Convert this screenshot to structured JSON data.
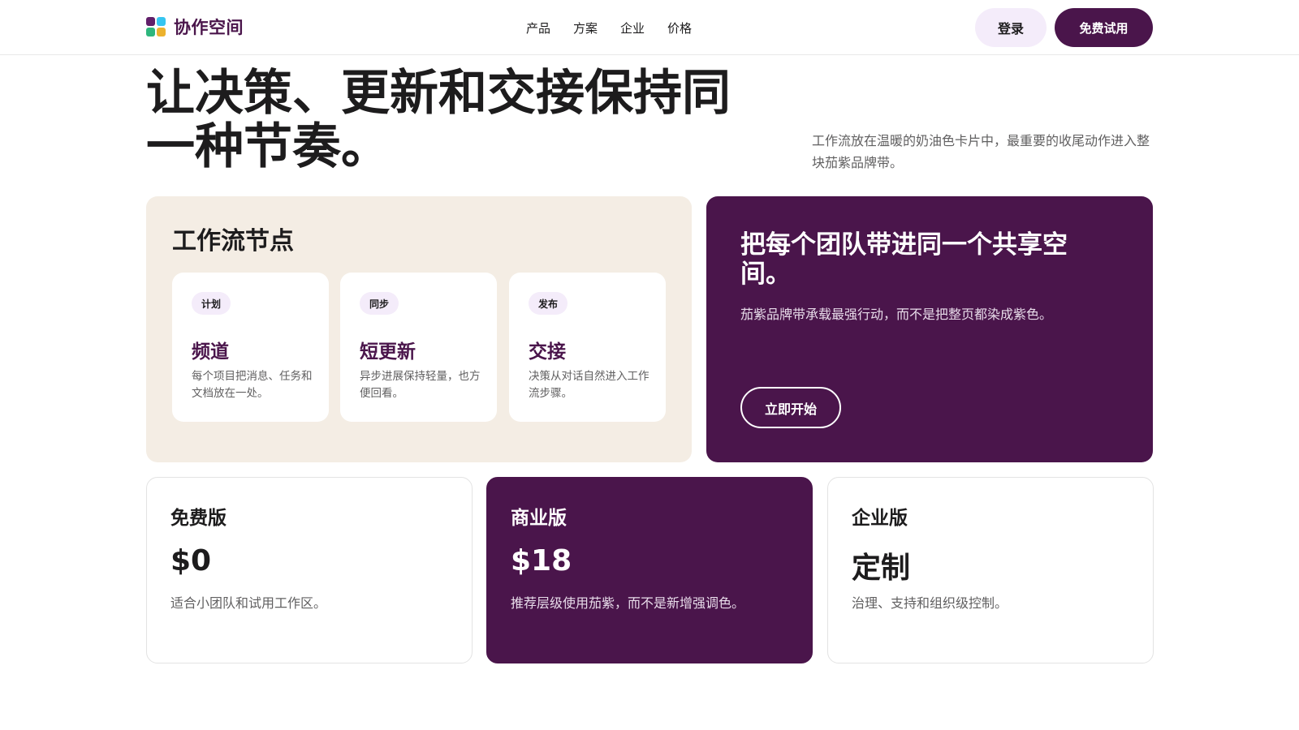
{
  "header": {
    "brand_name": "协作空间",
    "brand_colors": [
      "#611f69",
      "#36c5f0",
      "#2eb67d",
      "#ecb22e"
    ],
    "nav": [
      "产品",
      "方案",
      "企业",
      "价格"
    ],
    "login_label": "登录",
    "trial_label": "免费试用"
  },
  "hero": {
    "title": "让决策、更新和交接保持同一种节奏。",
    "description": "工作流放在温暖的奶油色卡片中，最重要的收尾动作进入整块茄紫品牌带。"
  },
  "workflow": {
    "title": "工作流节点",
    "nodes": [
      {
        "badge": "计划",
        "title": "频道",
        "description": "每个项目把消息、任务和文档放在一处。"
      },
      {
        "badge": "同步",
        "title": "短更新",
        "description": "异步进展保持轻量，也方便回看。"
      },
      {
        "badge": "发布",
        "title": "交接",
        "description": "决策从对话自然进入工作流步骤。"
      }
    ]
  },
  "promo": {
    "title": "把每个团队带进同一个共享空间。",
    "description": "茄紫品牌带承载最强行动，而不是把整页都染成紫色。",
    "button_label": "立即开始"
  },
  "pricing": {
    "plans": [
      {
        "name": "免费版",
        "price": "$0",
        "description": "适合小团队和试用工作区。"
      },
      {
        "name": "商业版",
        "price": "$18",
        "description": "推荐层级使用茄紫，而不是新增强调色。"
      },
      {
        "name": "企业版",
        "price": "定制",
        "description": "治理、支持和组织级控制。"
      }
    ]
  },
  "colors": {
    "brand_purple": "#4a154b",
    "cream": "#f4ede4",
    "lavender": "#f4ecfa"
  }
}
